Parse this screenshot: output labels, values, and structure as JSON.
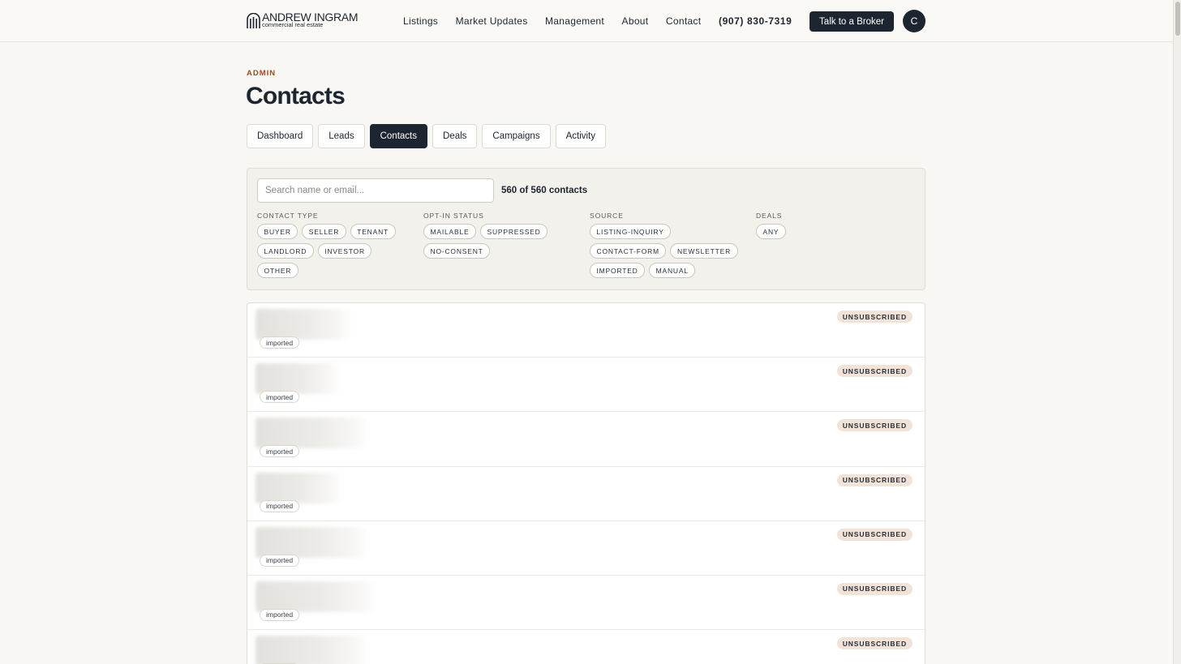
{
  "header": {
    "logo_name": "ANDREW INGRAM",
    "logo_sub": "commercial real estate",
    "nav": [
      "Listings",
      "Market Updates",
      "Management",
      "About",
      "Contact"
    ],
    "phone": "(907) 830-7319",
    "cta": "Talk to a Broker",
    "avatar_initial": "C"
  },
  "page": {
    "eyebrow": "ADMIN",
    "title": "Contacts"
  },
  "tabs": [
    {
      "label": "Dashboard",
      "active": false
    },
    {
      "label": "Leads",
      "active": false
    },
    {
      "label": "Contacts",
      "active": true
    },
    {
      "label": "Deals",
      "active": false
    },
    {
      "label": "Campaigns",
      "active": false
    },
    {
      "label": "Activity",
      "active": false
    }
  ],
  "filters": {
    "search_placeholder": "Search name or email...",
    "count": "560 of 560 contacts",
    "groups": [
      {
        "label": "CONTACT TYPE",
        "chips": [
          "BUYER",
          "SELLER",
          "TENANT",
          "LANDLORD",
          "INVESTOR",
          "OTHER"
        ]
      },
      {
        "label": "OPT-IN STATUS",
        "chips": [
          "MAILABLE",
          "SUPPRESSED",
          "NO-CONSENT"
        ]
      },
      {
        "label": "SOURCE",
        "chips": [
          "LISTING-INQUIRY",
          "CONTACT-FORM",
          "NEWSLETTER",
          "IMPORTED",
          "MANUAL"
        ]
      },
      {
        "label": "DEALS",
        "chips": [
          "ANY"
        ]
      }
    ]
  },
  "contacts": [
    {
      "source": "imported",
      "status": "UNSUBSCRIBED"
    },
    {
      "source": "imported",
      "status": "UNSUBSCRIBED"
    },
    {
      "source": "imported",
      "status": "UNSUBSCRIBED"
    },
    {
      "source": "imported",
      "status": "UNSUBSCRIBED"
    },
    {
      "source": "imported",
      "status": "UNSUBSCRIBED"
    },
    {
      "source": "imported",
      "status": "UNSUBSCRIBED"
    },
    {
      "source": "imported",
      "status": "UNSUBSCRIBED"
    }
  ],
  "colors": {
    "navy": "#1c2530",
    "accent": "#9a4d1e",
    "badge_bg": "#f1e3d8",
    "page_bg": "#f8f7f3"
  }
}
